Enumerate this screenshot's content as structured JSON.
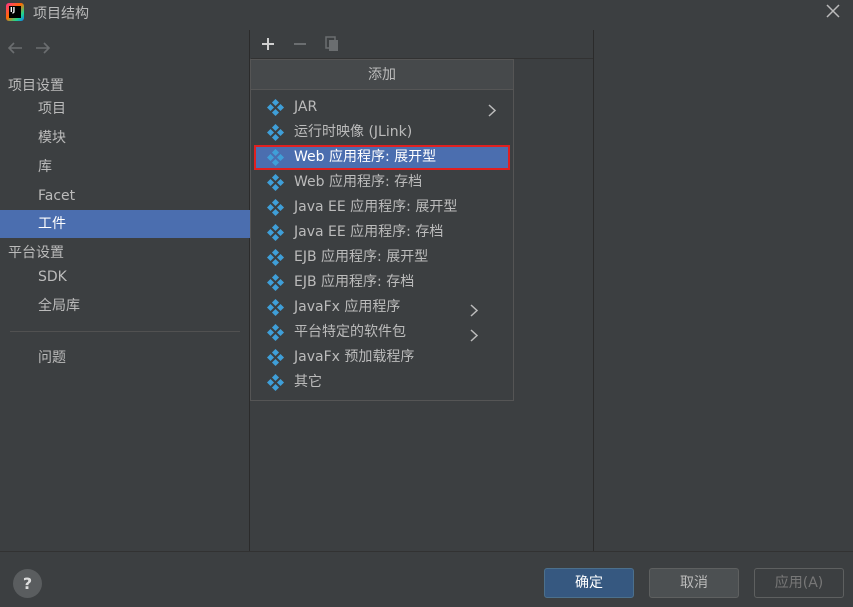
{
  "window": {
    "title": "项目结构",
    "app_icon_text": "IJ"
  },
  "sidebar": {
    "section_project": "项目设置",
    "project_items": [
      "项目",
      "模块",
      "库",
      "Facet",
      "工件"
    ],
    "selected": "工件",
    "section_platform": "平台设置",
    "platform_items": [
      "SDK",
      "全局库"
    ],
    "problems": "问题"
  },
  "popup": {
    "title": "添加",
    "items": [
      {
        "label": "JAR",
        "submenu": true
      },
      {
        "label": "运行时映像 (JLink)",
        "submenu": false
      },
      {
        "label": "Web 应用程序: 展开型",
        "submenu": false,
        "highlighted": true
      },
      {
        "label": "Web 应用程序: 存档",
        "submenu": false
      },
      {
        "label": "Java EE 应用程序: 展开型",
        "submenu": false
      },
      {
        "label": "Java EE 应用程序: 存档",
        "submenu": false
      },
      {
        "label": "EJB 应用程序: 展开型",
        "submenu": false
      },
      {
        "label": "EJB 应用程序: 存档",
        "submenu": false
      },
      {
        "label": "JavaFx 应用程序",
        "submenu": true
      },
      {
        "label": "平台特定的软件包",
        "submenu": true
      },
      {
        "label": "JavaFx 预加载程序",
        "submenu": false
      },
      {
        "label": "其它",
        "submenu": false
      }
    ]
  },
  "footer": {
    "help": "?",
    "ok": "确定",
    "cancel": "取消",
    "apply": "应用(A)"
  },
  "colors": {
    "accent": "#4b6eaf",
    "primary_button": "#365880",
    "highlight_outline": "#e02020",
    "artifact_icon": "#3f9fd8"
  }
}
